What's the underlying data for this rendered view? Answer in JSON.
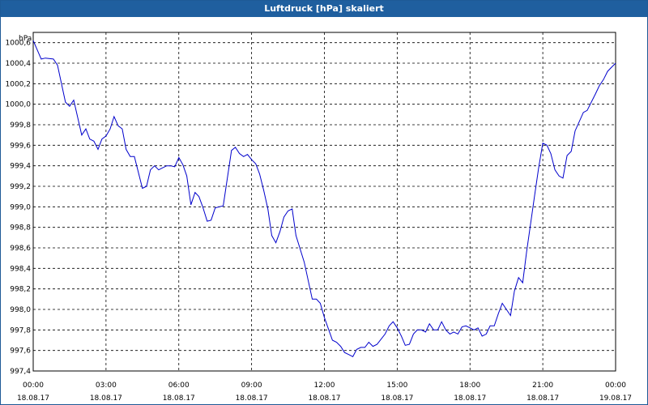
{
  "window": {
    "title": "Luftdruck [hPa] skaliert"
  },
  "chart_data": {
    "type": "line",
    "title": "Luftdruck [hPa] skaliert",
    "ylabel": "hPa",
    "xlabel": "",
    "ylim": [
      997.4,
      1000.7
    ],
    "xlim_hours": [
      0,
      24
    ],
    "grid": true,
    "y_ticks": [
      "997,4",
      "997,6",
      "997,8",
      "998,0",
      "998,2",
      "998,4",
      "998,6",
      "998,8",
      "999,0",
      "999,2",
      "999,4",
      "999,6",
      "999,8",
      "1000,0",
      "1000,2",
      "1000,4",
      "1000,6"
    ],
    "y_tick_values": [
      997.4,
      997.6,
      997.8,
      998.0,
      998.2,
      998.4,
      998.6,
      998.8,
      999.0,
      999.2,
      999.4,
      999.6,
      999.8,
      1000.0,
      1000.2,
      1000.4,
      1000.6
    ],
    "x_ticks": [
      {
        "time": "00:00",
        "date": "18.08.17"
      },
      {
        "time": "03:00",
        "date": "18.08.17"
      },
      {
        "time": "06:00",
        "date": "18.08.17"
      },
      {
        "time": "09:00",
        "date": "18.08.17"
      },
      {
        "time": "12:00",
        "date": "18.08.17"
      },
      {
        "time": "15:00",
        "date": "18.08.17"
      },
      {
        "time": "18:00",
        "date": "18.08.17"
      },
      {
        "time": "21:00",
        "date": "18.08.17"
      },
      {
        "time": "00:00",
        "date": "19.08.17"
      }
    ],
    "x_tick_hours": [
      0,
      3,
      6,
      9,
      12,
      15,
      18,
      21,
      24
    ],
    "series": [
      {
        "color": "#0000cc",
        "points": [
          [
            0.0,
            1000.62
          ],
          [
            0.33,
            1000.44
          ],
          [
            0.5,
            1000.45
          ],
          [
            0.83,
            1000.44
          ],
          [
            1.0,
            1000.38
          ],
          [
            1.33,
            1000.02
          ],
          [
            1.5,
            999.98
          ],
          [
            1.67,
            1000.04
          ],
          [
            2.0,
            999.7
          ],
          [
            2.17,
            999.76
          ],
          [
            2.33,
            999.66
          ],
          [
            2.5,
            999.64
          ],
          [
            2.67,
            999.56
          ],
          [
            2.83,
            999.66
          ],
          [
            3.0,
            999.69
          ],
          [
            3.17,
            999.76
          ],
          [
            3.33,
            999.88
          ],
          [
            3.5,
            999.79
          ],
          [
            3.67,
            999.76
          ],
          [
            3.83,
            999.56
          ],
          [
            4.0,
            999.49
          ],
          [
            4.17,
            999.49
          ],
          [
            4.33,
            999.34
          ],
          [
            4.5,
            999.18
          ],
          [
            4.67,
            999.2
          ],
          [
            4.83,
            999.36
          ],
          [
            5.0,
            999.4
          ],
          [
            5.17,
            999.36
          ],
          [
            5.33,
            999.38
          ],
          [
            5.5,
            999.4
          ],
          [
            5.67,
            999.4
          ],
          [
            5.83,
            999.39
          ],
          [
            6.0,
            999.48
          ],
          [
            6.17,
            999.41
          ],
          [
            6.33,
            999.3
          ],
          [
            6.5,
            999.02
          ],
          [
            6.67,
            999.14
          ],
          [
            6.83,
            999.1
          ],
          [
            7.0,
            998.99
          ],
          [
            7.17,
            998.86
          ],
          [
            7.33,
            998.87
          ],
          [
            7.5,
            998.99
          ],
          [
            7.67,
            999.0
          ],
          [
            7.83,
            999.01
          ],
          [
            8.17,
            999.55
          ],
          [
            8.33,
            999.58
          ],
          [
            8.5,
            999.52
          ],
          [
            8.67,
            999.49
          ],
          [
            8.83,
            999.51
          ],
          [
            9.0,
            999.46
          ],
          [
            9.17,
            999.42
          ],
          [
            9.33,
            999.32
          ],
          [
            9.5,
            999.16
          ],
          [
            9.67,
            998.98
          ],
          [
            9.83,
            998.72
          ],
          [
            10.0,
            998.65
          ],
          [
            10.17,
            998.76
          ],
          [
            10.33,
            998.9
          ],
          [
            10.5,
            998.96
          ],
          [
            10.67,
            998.98
          ],
          [
            10.83,
            998.72
          ],
          [
            11.17,
            998.46
          ],
          [
            11.5,
            998.1
          ],
          [
            11.67,
            998.1
          ],
          [
            11.83,
            998.06
          ],
          [
            12.0,
            997.92
          ],
          [
            12.33,
            997.7
          ],
          [
            12.5,
            997.68
          ],
          [
            12.67,
            997.64
          ],
          [
            12.83,
            997.58
          ],
          [
            13.0,
            997.56
          ],
          [
            13.17,
            997.54
          ],
          [
            13.33,
            997.61
          ],
          [
            13.5,
            997.63
          ],
          [
            13.67,
            997.63
          ],
          [
            13.83,
            997.68
          ],
          [
            14.0,
            997.64
          ],
          [
            14.17,
            997.66
          ],
          [
            14.5,
            997.76
          ],
          [
            14.67,
            997.84
          ],
          [
            14.83,
            997.88
          ],
          [
            15.0,
            997.82
          ],
          [
            15.17,
            997.74
          ],
          [
            15.33,
            997.65
          ],
          [
            15.5,
            997.66
          ],
          [
            15.67,
            997.76
          ],
          [
            15.83,
            997.8
          ],
          [
            16.0,
            997.8
          ],
          [
            16.17,
            997.78
          ],
          [
            16.33,
            997.86
          ],
          [
            16.5,
            997.8
          ],
          [
            16.67,
            997.8
          ],
          [
            16.83,
            997.88
          ],
          [
            17.0,
            997.8
          ],
          [
            17.17,
            997.76
          ],
          [
            17.33,
            997.78
          ],
          [
            17.5,
            997.76
          ],
          [
            17.67,
            997.83
          ],
          [
            17.83,
            997.84
          ],
          [
            18.0,
            997.82
          ],
          [
            18.17,
            997.8
          ],
          [
            18.33,
            997.82
          ],
          [
            18.5,
            997.74
          ],
          [
            18.67,
            997.76
          ],
          [
            18.83,
            997.84
          ],
          [
            19.0,
            997.84
          ],
          [
            19.17,
            997.96
          ],
          [
            19.33,
            998.06
          ],
          [
            19.5,
            998.0
          ],
          [
            19.67,
            997.94
          ],
          [
            19.83,
            998.18
          ],
          [
            20.0,
            998.31
          ],
          [
            20.17,
            998.26
          ],
          [
            20.33,
            998.56
          ],
          [
            20.67,
            999.12
          ],
          [
            20.83,
            999.38
          ],
          [
            21.0,
            999.62
          ],
          [
            21.17,
            999.6
          ],
          [
            21.33,
            999.52
          ],
          [
            21.5,
            999.36
          ],
          [
            21.67,
            999.3
          ],
          [
            21.83,
            999.28
          ],
          [
            22.0,
            999.5
          ],
          [
            22.17,
            999.54
          ],
          [
            22.33,
            999.74
          ],
          [
            22.67,
            999.92
          ],
          [
            22.83,
            999.94
          ],
          [
            23.0,
            1000.02
          ],
          [
            23.17,
            1000.1
          ],
          [
            23.33,
            1000.18
          ],
          [
            23.5,
            1000.24
          ],
          [
            23.67,
            1000.32
          ],
          [
            23.83,
            1000.36
          ],
          [
            24.0,
            1000.4
          ]
        ]
      }
    ]
  }
}
